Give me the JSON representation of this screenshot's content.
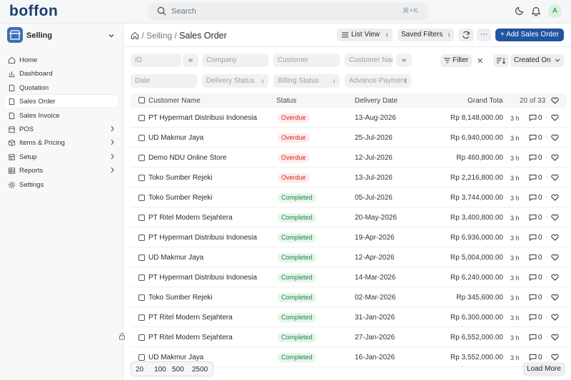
{
  "app": {
    "logo": "boffon",
    "avatar_initial": "A"
  },
  "search": {
    "placeholder": "Search",
    "shortcut": "⌘+K"
  },
  "sidebar": {
    "workspace": "Selling",
    "items": [
      {
        "label": "Home",
        "icon": "home-icon"
      },
      {
        "label": "Dashboard",
        "icon": "bar-chart-icon"
      },
      {
        "label": "Quotation",
        "icon": "file-icon"
      },
      {
        "label": "Sales Order",
        "icon": "file-icon",
        "active": true
      },
      {
        "label": "Sales Invoice",
        "icon": "file-icon"
      },
      {
        "label": "POS",
        "icon": "store-icon",
        "expandable": true
      },
      {
        "label": "Items & Pricing",
        "icon": "box-icon",
        "expandable": true
      },
      {
        "label": "Setup",
        "icon": "setup-icon",
        "expandable": true
      },
      {
        "label": "Reports",
        "icon": "table-icon",
        "expandable": true
      },
      {
        "label": "Settings",
        "icon": "gear-icon"
      }
    ]
  },
  "header": {
    "breadcrumb": [
      "Selling",
      "Sales Order"
    ],
    "list_view": "List View",
    "saved_filters": "Saved Filters",
    "add_button": "+ Add Sales Order"
  },
  "filters": {
    "id": "ID",
    "company": "Company",
    "customer": "Customer",
    "customer_name": "Customer Name",
    "filter_button": "Filter",
    "sort": "Created On",
    "date": "Date",
    "delivery_status": "Delivery Status",
    "billing_status": "Billing Status",
    "advance_payment": "Advance Payment"
  },
  "table": {
    "columns": [
      "Customer Name",
      "Status",
      "Delivery Date",
      "Grand Total"
    ],
    "count": "20 of 33",
    "rows": [
      {
        "customer": "PT Hypermart Distribusi Indonesia",
        "status": "Overdue",
        "date": "13-Aug-2026",
        "total": "Rp 8,148,000.00",
        "age": "3 h",
        "comments": "0"
      },
      {
        "customer": "UD Makmur Jaya",
        "status": "Overdue",
        "date": "25-Jul-2026",
        "total": "Rp 6,940,000.00",
        "age": "3 h",
        "comments": "0"
      },
      {
        "customer": "Demo NDU Online Store",
        "status": "Overdue",
        "date": "12-Jul-2026",
        "total": "Rp 460,800.00",
        "age": "3 h",
        "comments": "0"
      },
      {
        "customer": "Toko Sumber Rejeki",
        "status": "Overdue",
        "date": "13-Jul-2026",
        "total": "Rp 2,216,800.00",
        "age": "3 h",
        "comments": "0"
      },
      {
        "customer": "Toko Sumber Rejeki",
        "status": "Completed",
        "date": "05-Jul-2026",
        "total": "Rp 3,744,000.00",
        "age": "3 h",
        "comments": "0"
      },
      {
        "customer": "PT Ritel Modern Sejahtera",
        "status": "Completed",
        "date": "20-May-2026",
        "total": "Rp 3,400,800.00",
        "age": "3 h",
        "comments": "0"
      },
      {
        "customer": "PT Hypermart Distribusi Indonesia",
        "status": "Completed",
        "date": "19-Apr-2026",
        "total": "Rp 6,936,000.00",
        "age": "3 h",
        "comments": "0"
      },
      {
        "customer": "UD Makmur Jaya",
        "status": "Completed",
        "date": "12-Apr-2026",
        "total": "Rp 5,004,000.00",
        "age": "3 h",
        "comments": "0"
      },
      {
        "customer": "PT Hypermart Distribusi Indonesia",
        "status": "Completed",
        "date": "14-Mar-2026",
        "total": "Rp 6,240,000.00",
        "age": "3 h",
        "comments": "0"
      },
      {
        "customer": "Toko Sumber Rejeki",
        "status": "Completed",
        "date": "02-Mar-2026",
        "total": "Rp 345,600.00",
        "age": "3 h",
        "comments": "0"
      },
      {
        "customer": "PT Ritel Modern Sejahtera",
        "status": "Completed",
        "date": "31-Jan-2026",
        "total": "Rp 6,300,000.00",
        "age": "3 h",
        "comments": "0"
      },
      {
        "customer": "PT Ritel Modern Sejahtera",
        "status": "Completed",
        "date": "27-Jan-2026",
        "total": "Rp 6,552,000.00",
        "age": "3 h",
        "comments": "0"
      },
      {
        "customer": "UD Makmur Jaya",
        "status": "Completed",
        "date": "16-Jan-2026",
        "total": "Rp 3,552,000.00",
        "age": "3 h",
        "comments": "0"
      }
    ]
  },
  "footer": {
    "page_sizes": [
      "20",
      "100",
      "500",
      "2500"
    ],
    "load_more": "Load More"
  },
  "colors": {
    "primary": "#2254a0",
    "overdue": "#d12a2a",
    "completed": "#268246"
  }
}
